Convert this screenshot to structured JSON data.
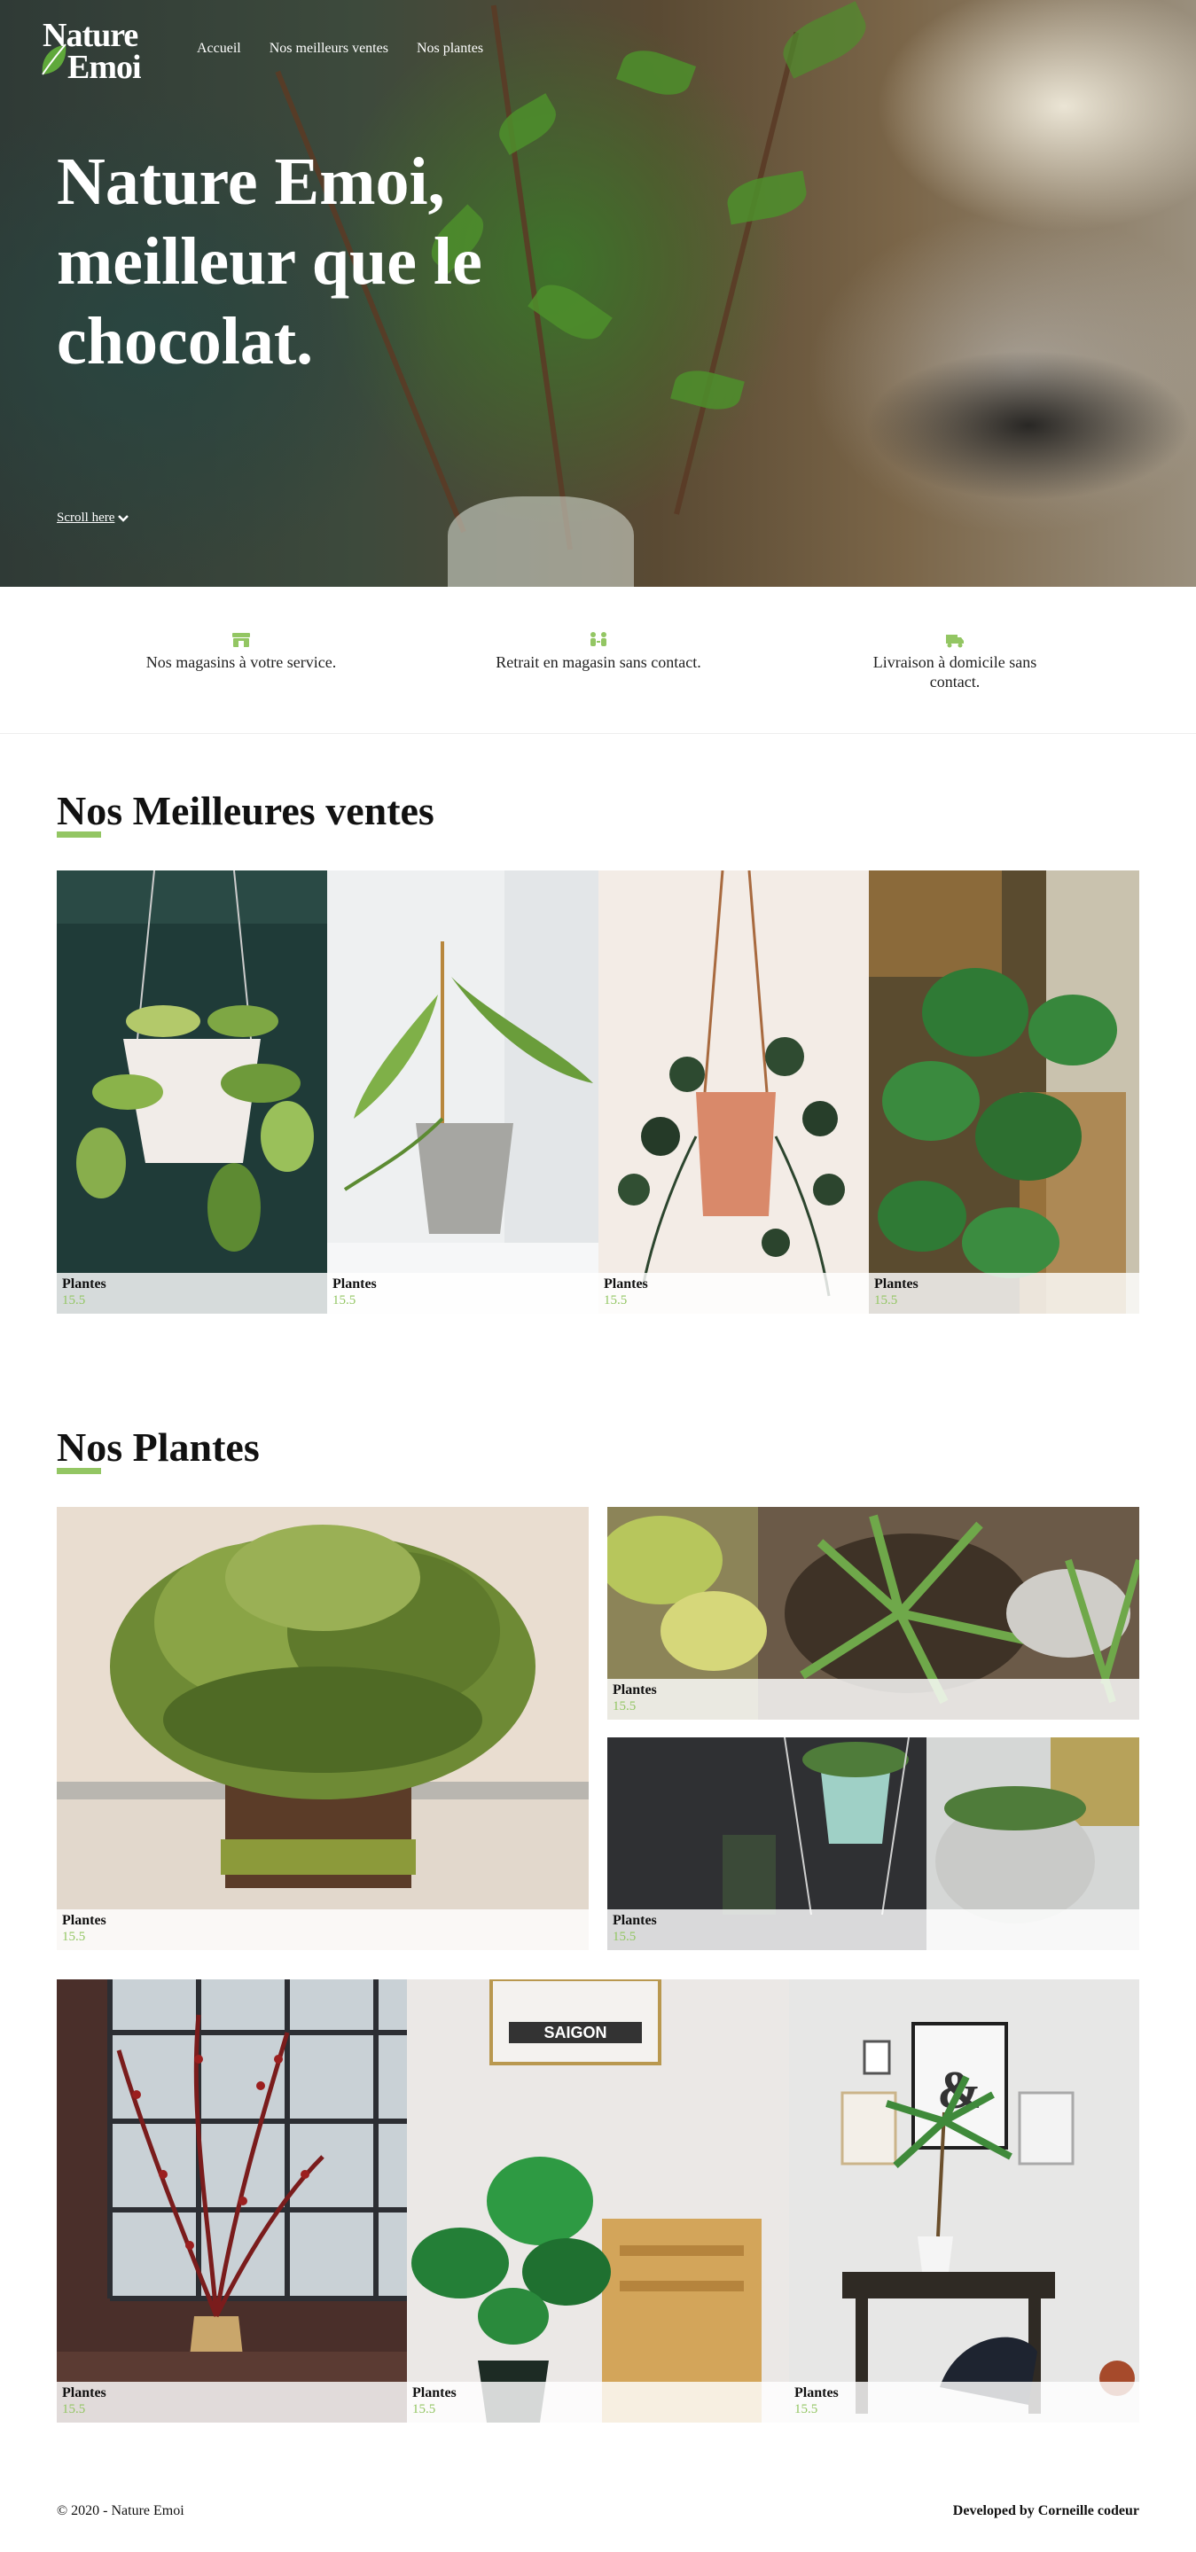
{
  "brand": {
    "line1": "Nature",
    "line2": "Emoi"
  },
  "nav": [
    {
      "label": "Accueil"
    },
    {
      "label": "Nos meilleurs ventes"
    },
    {
      "label": "Nos plantes"
    }
  ],
  "hero": {
    "title": "Nature Emoi, meilleur que le chocolat.",
    "scroll_label": "Scroll here"
  },
  "features": [
    {
      "icon": "store-icon",
      "text": "Nos magasins à votre service."
    },
    {
      "icon": "contactless-pickup-icon",
      "text": "Retrait en magasin sans contact."
    },
    {
      "icon": "delivery-truck-icon",
      "text": "Livraison à domicile sans contact."
    }
  ],
  "best_sellers": {
    "title": "Nos Meilleures ventes",
    "items": [
      {
        "name": "Plantes",
        "price": "15.5"
      },
      {
        "name": "Plantes",
        "price": "15.5"
      },
      {
        "name": "Plantes",
        "price": "15.5"
      },
      {
        "name": "Plantes",
        "price": "15.5"
      }
    ]
  },
  "plants": {
    "title": "Nos Plantes",
    "items": [
      {
        "name": "Plantes",
        "price": "15.5"
      },
      {
        "name": "Plantes",
        "price": "15.5"
      },
      {
        "name": "Plantes",
        "price": "15.5"
      },
      {
        "name": "Plantes",
        "price": "15.5"
      },
      {
        "name": "Plantes",
        "price": "15.5"
      },
      {
        "name": "Plantes",
        "price": "15.5"
      }
    ]
  },
  "footer": {
    "copyright": "© 2020 - Nature Emoi",
    "credit": "Developed by Corneille codeur"
  },
  "colors": {
    "accent": "#93c663",
    "text": "#111111",
    "hero_text": "#ffffff"
  }
}
